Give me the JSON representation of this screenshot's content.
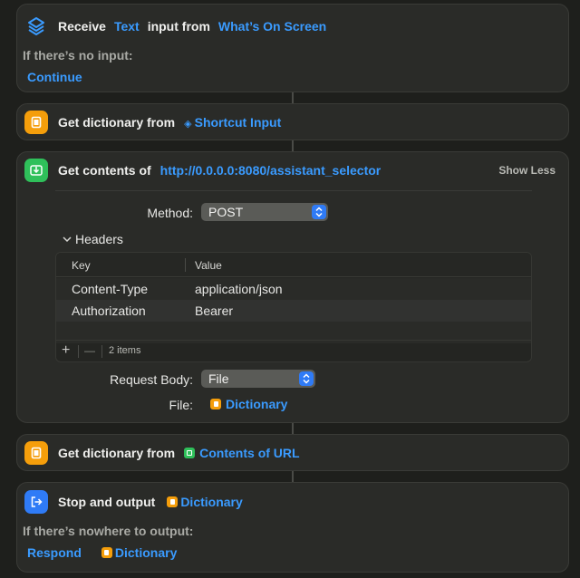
{
  "receive_card": {
    "title": "Receive",
    "type_token": "Text",
    "middle_text": "input from",
    "source_token": "What’s On Screen",
    "no_input_label": "If there’s no input:",
    "no_input_action": "Continue"
  },
  "get_dict_card_1": {
    "title": "Get dictionary from",
    "token": "Shortcut Input"
  },
  "get_contents_card": {
    "title": "Get contents of",
    "url": "http://0.0.0.0:8080/assistant_selector",
    "show_less": "Show Less",
    "method_label": "Method:",
    "method_value": "POST",
    "headers_label": "Headers",
    "table": {
      "col_key": "Key",
      "col_value": "Value",
      "rows": [
        {
          "key": "Content-Type",
          "value": "application/json"
        },
        {
          "key": "Authorization",
          "value": "Bearer"
        }
      ],
      "add": "+",
      "remove": "—",
      "count": "2 items"
    },
    "body_label": "Request Body:",
    "body_value": "File",
    "file_label": "File:",
    "file_token": "Dictionary"
  },
  "get_dict_card_2": {
    "title": "Get dictionary from",
    "token": "Contents of URL"
  },
  "stop_card": {
    "title": "Stop and output",
    "token": "Dictionary",
    "nowhere_label": "If there’s nowhere to output:",
    "respond": "Respond",
    "respond_token": "Dictionary"
  },
  "colors": {
    "background": "#1e1f1c",
    "card": "#2a2b28",
    "accent_blue": "#3a9bff",
    "orange_icon": "#f59e0b",
    "green_icon": "#2fc05a",
    "blue_icon": "#2f7bf6"
  },
  "icons": [
    "shortcuts-layers-icon",
    "dictionary-icon",
    "download-icon",
    "output-exit-icon",
    "chevron-down-icon",
    "updown-chevrons-icon"
  ]
}
